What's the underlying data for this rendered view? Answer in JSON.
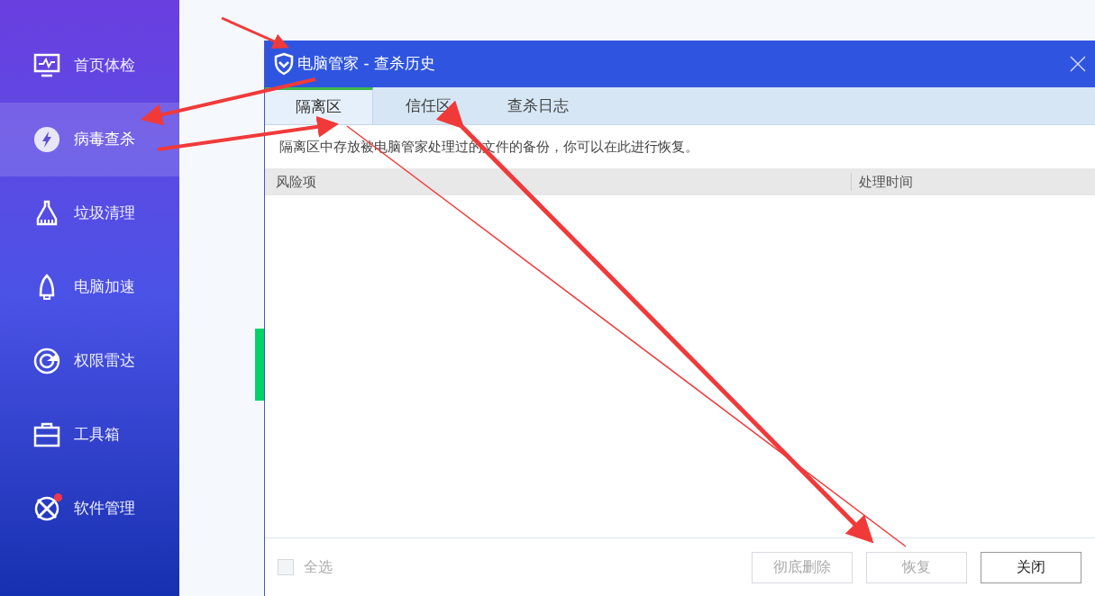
{
  "sidebar": {
    "items": [
      {
        "label": "首页体检",
        "kind": "monitor",
        "selected": false,
        "badge": false
      },
      {
        "label": "病毒查杀",
        "kind": "bolt",
        "selected": true,
        "badge": false
      },
      {
        "label": "垃圾清理",
        "kind": "broom",
        "selected": false,
        "badge": false
      },
      {
        "label": "电脑加速",
        "kind": "rocket",
        "selected": false,
        "badge": false
      },
      {
        "label": "权限雷达",
        "kind": "radar",
        "selected": false,
        "badge": false
      },
      {
        "label": "工具箱",
        "kind": "toolbox",
        "selected": false,
        "badge": false
      },
      {
        "label": "软件管理",
        "kind": "apps",
        "selected": false,
        "badge": true
      }
    ]
  },
  "dialog": {
    "title": "电脑管家 - 查杀历史",
    "tabs": [
      {
        "label": "隔离区",
        "selected": true
      },
      {
        "label": "信任区",
        "selected": false
      },
      {
        "label": "查杀日志",
        "selected": false
      }
    ],
    "description": "隔离区中存放被电脑管家处理过的文件的备份，你可以在此进行恢复。",
    "table": {
      "columns": [
        "风险项",
        "处理时间"
      ]
    },
    "select_all": {
      "label": "全选",
      "checked": false,
      "disabled": true
    },
    "buttons": [
      {
        "label": "彻底删除",
        "disabled": true
      },
      {
        "label": "恢复",
        "disabled": true
      },
      {
        "label": "关闭",
        "disabled": false
      }
    ]
  }
}
